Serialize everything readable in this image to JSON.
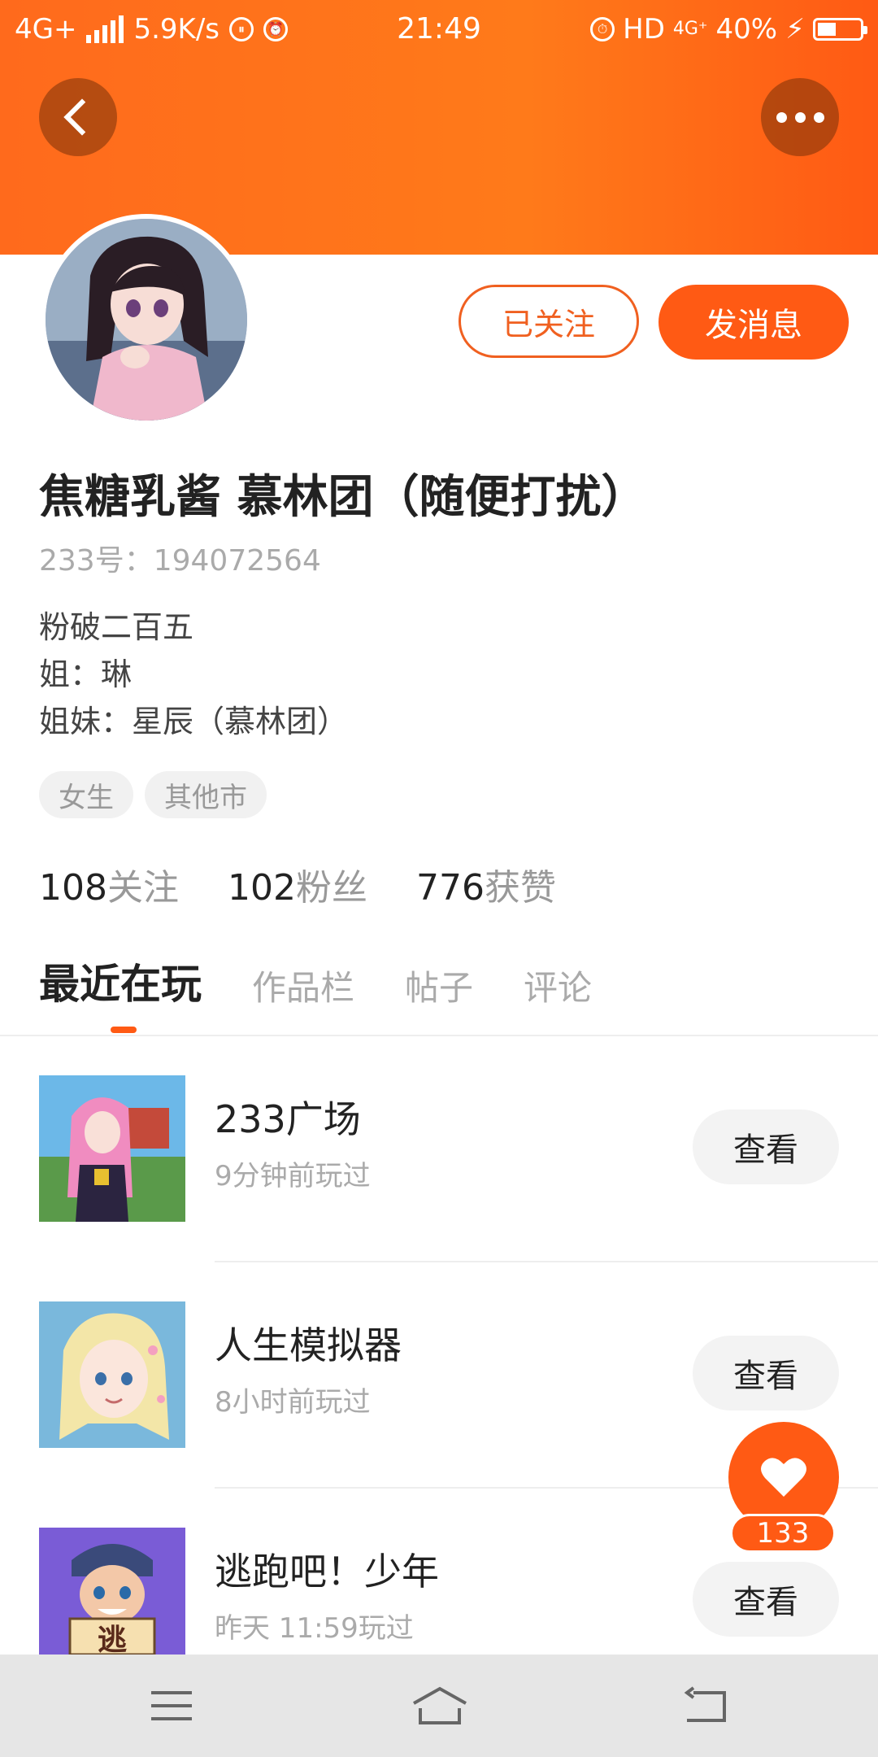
{
  "status_bar": {
    "network": "4G+",
    "speed": "5.9K/s",
    "time": "21:49",
    "hd": "HD",
    "net2": "4G⁺",
    "battery": "40%"
  },
  "profile": {
    "followed_label": "已关注",
    "message_label": "发消息",
    "username": "焦糖乳酱 慕林团（随便打扰）",
    "id_text": "233号：194072564",
    "bio": [
      "粉破二百五",
      "姐：琳",
      "姐妹：星辰（慕林团）"
    ],
    "tags": [
      "女生",
      "其他市"
    ],
    "stats": [
      {
        "num": "108",
        "label": "关注"
      },
      {
        "num": "102",
        "label": "粉丝"
      },
      {
        "num": "776",
        "label": "获赞"
      }
    ]
  },
  "tabs": [
    "最近在玩",
    "作品栏",
    "帖子",
    "评论"
  ],
  "games": [
    {
      "name": "233广场",
      "time": "9分钟前玩过",
      "button": "查看"
    },
    {
      "name": "人生模拟器",
      "time": "8小时前玩过",
      "button": "查看"
    },
    {
      "name": "逃跑吧！少年",
      "time": "昨天 11:59玩过",
      "button": "查看"
    }
  ],
  "thumb3_text": "逃",
  "like": {
    "count": "133"
  },
  "colors": {
    "accent": "#ff5a14",
    "header": "#ff7a1a"
  }
}
